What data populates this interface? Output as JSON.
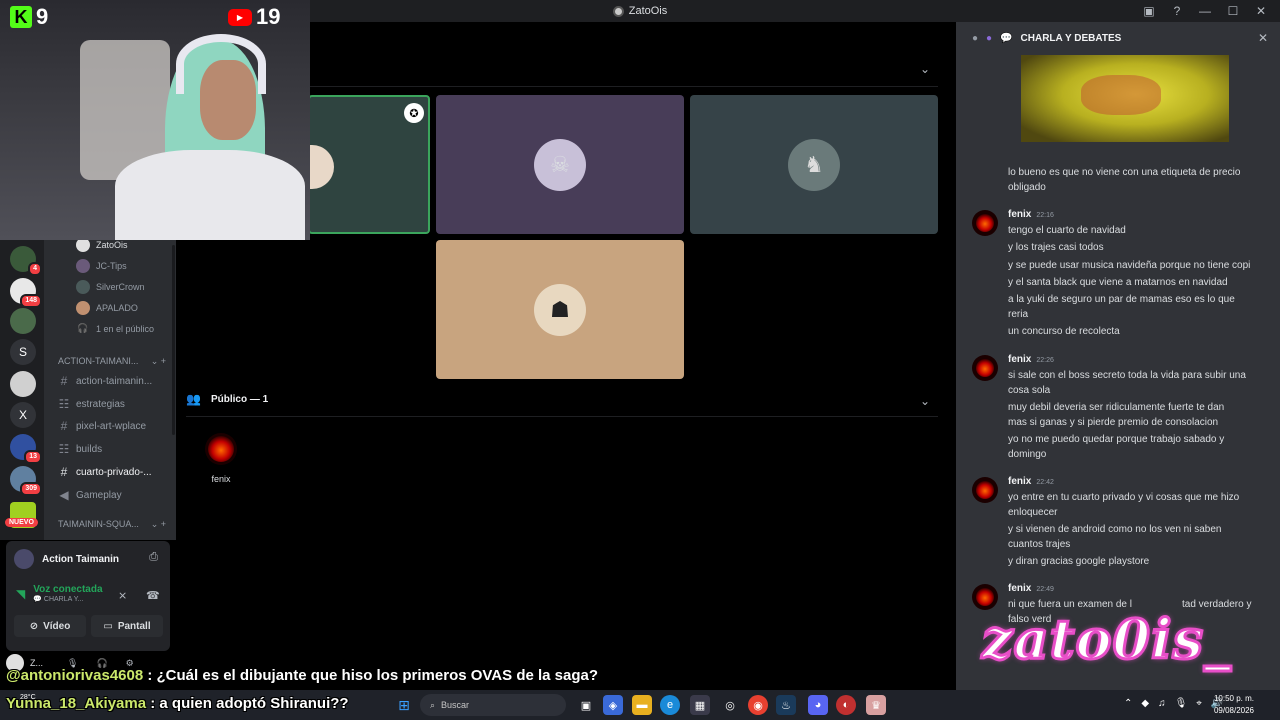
{
  "window": {
    "title": "ZatoOis"
  },
  "webcam": {
    "kick_count": "9",
    "youtube_count": "19"
  },
  "servers": [
    {
      "letter": "",
      "badge": "4",
      "color": "#3a5a3a"
    },
    {
      "letter": "",
      "badge": "148",
      "color": "#e8e8e8"
    },
    {
      "letter": "",
      "badge": "",
      "color": "#4a6a4a"
    },
    {
      "letter": "S",
      "badge": "",
      "color": "#313338"
    },
    {
      "letter": "",
      "badge": "",
      "color": "#d0d0d0"
    },
    {
      "letter": "X",
      "badge": "",
      "color": "#313338"
    },
    {
      "letter": "",
      "badge": "13",
      "color": "#3050a0"
    },
    {
      "letter": "",
      "badge": "309",
      "color": "#6080a0"
    },
    {
      "letter": "",
      "badge": "",
      "color": "#a0d020"
    }
  ],
  "nuevo_label": "NUEVO",
  "voice_users": [
    {
      "name": "ZatoOis",
      "color": "#e0e0e0"
    },
    {
      "name": "JC-Tips",
      "color": "#6a5a7a"
    },
    {
      "name": "SilverCrown",
      "color": "#4a5a5a"
    },
    {
      "name": "APALADO",
      "color": "#c09070"
    }
  ],
  "audience_count": "1 en el público",
  "categories": [
    "ACTION-TAIMANI...",
    "TAIMAININ-SQUA..."
  ],
  "channels": [
    {
      "name": "action-taimanin...",
      "sym": "#"
    },
    {
      "name": "estrategias",
      "sym": "☷"
    },
    {
      "name": "pixel-art-wplace",
      "sym": "#"
    },
    {
      "name": "builds",
      "sym": "☷"
    },
    {
      "name": "cuarto-privado-...",
      "sym": "#"
    },
    {
      "name": "Gameplay",
      "sym": "◀"
    }
  ],
  "voice_panel": {
    "server_name": "Action Taimanin",
    "status": "Voz conectada",
    "channel": "CHARLA Y...",
    "video_label": "Vídeo",
    "screen_label": "Pantall"
  },
  "user_panel": {
    "name": "Z..."
  },
  "stage": {
    "public_header": "Público — 1",
    "audience_name": "fenix"
  },
  "chat": {
    "channel_title": "CHARLA Y DEBATES",
    "intro_lines": [
      "lo bueno es que no viene con una etiqueta de precio",
      "obligado"
    ],
    "groups": [
      {
        "author": "fenix",
        "time": "22:16",
        "lines": [
          "tengo el cuarto de navidad",
          "y los trajes casi todos",
          "y se puede usar musica navideña porque no tiene copi",
          "y el santa black que viene a matarnos en navidad",
          "a la yuki de seguro un par de mamas eso es lo que",
          "reria",
          "un concurso de recolecta"
        ]
      },
      {
        "author": "fenix",
        "time": "22:26",
        "lines": [
          "si sale con el boss secreto toda la vida para subir una",
          "cosa sola",
          "muy debil deveria ser ridiculamente fuerte te dan",
          "mas si ganas y si pierde premio de consolacion",
          "yo no me puedo quedar porque trabajo sabado y",
          "domingo"
        ]
      },
      {
        "author": "fenix",
        "time": "22:42",
        "lines": [
          "yo entre en tu cuarto privado y vi cosas que me hizo",
          "enloquecer",
          "y si vienen de android como no los ven ni saben",
          "cuantos trajes",
          "y diran gracias google playstore"
        ]
      },
      {
        "author": "fenix",
        "time": "22:49",
        "lines": [
          "ni que fuera un examen de l",
          "tad verdadero y",
          "falso verd"
        ]
      }
    ]
  },
  "overlay": {
    "line1_user": "@antoniorivas4608",
    "line1_text": " : ¿Cuál es el dibujante que hiso los primeros OVAS de la saga?",
    "line2_user": "Yunna_18_Akiyama",
    "line2_text": " : a quien adoptó Shiranui??",
    "logo_text": "zato0is_"
  },
  "taskbar": {
    "search_placeholder": "Buscar",
    "temp": "28°C",
    "time": "10:50 p. m.",
    "date": "09/08/2026"
  },
  "colors": {
    "kick": "#53fc18",
    "youtube": "#ff0000",
    "discord_bg": "#313338",
    "overlay_user": "#cbe86b",
    "logo_pink": "#e84ec8"
  }
}
